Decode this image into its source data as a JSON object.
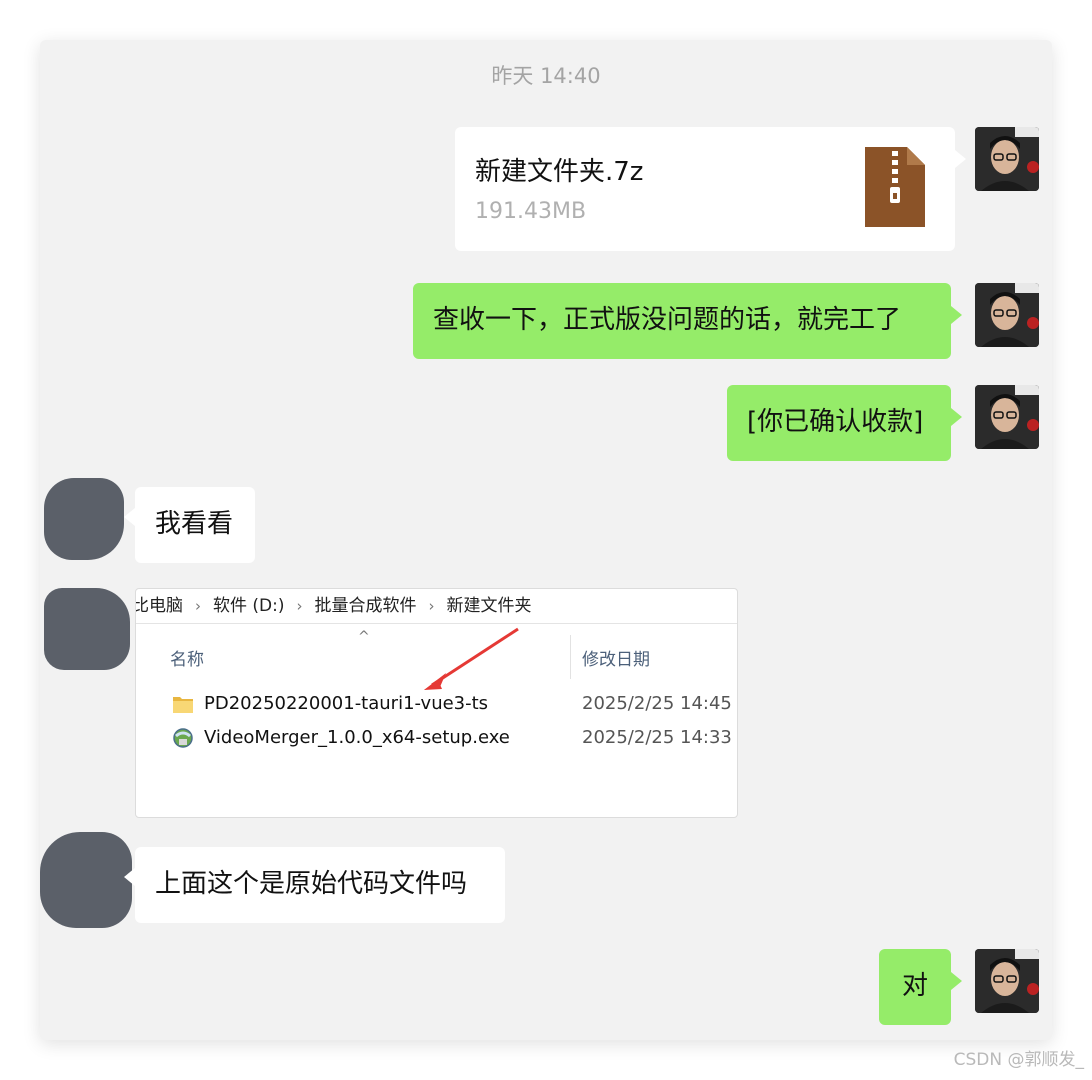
{
  "chat": {
    "timestamp": "昨天 14:40",
    "file_message": {
      "name": "新建文件夹.7z",
      "size": "191.43MB",
      "icon": "zip-file-icon"
    },
    "messages": [
      {
        "side": "right",
        "text": "查收一下，正式版没问题的话，就完工了"
      },
      {
        "side": "right",
        "text": "[你已确认收款]"
      },
      {
        "side": "left",
        "text": "我看看"
      },
      {
        "side": "left",
        "text": "上面这个是原始代码文件吗"
      },
      {
        "side": "right",
        "text": "对"
      }
    ]
  },
  "explorer_screenshot": {
    "breadcrumb": [
      "比电脑",
      "软件 (D:)",
      "批量合成软件",
      "新建文件夹"
    ],
    "columns": {
      "name": "名称",
      "modified": "修改日期"
    },
    "rows": [
      {
        "name": "PD20250220001-tauri1-vue3-ts",
        "date": "2025/2/25 14:45",
        "icon": "folder-icon"
      },
      {
        "name": "VideoMerger_1.0.0_x64-setup.exe",
        "date": "2025/2/25 14:33",
        "icon": "installer-icon"
      }
    ]
  },
  "watermark": "CSDN @郭顺发_",
  "colors": {
    "sent_bubble": "#95ec69",
    "received_bubble": "#ffffff",
    "background": "#f2f2f2",
    "arrow": "#e53935",
    "zip_icon": "#8b5328"
  }
}
